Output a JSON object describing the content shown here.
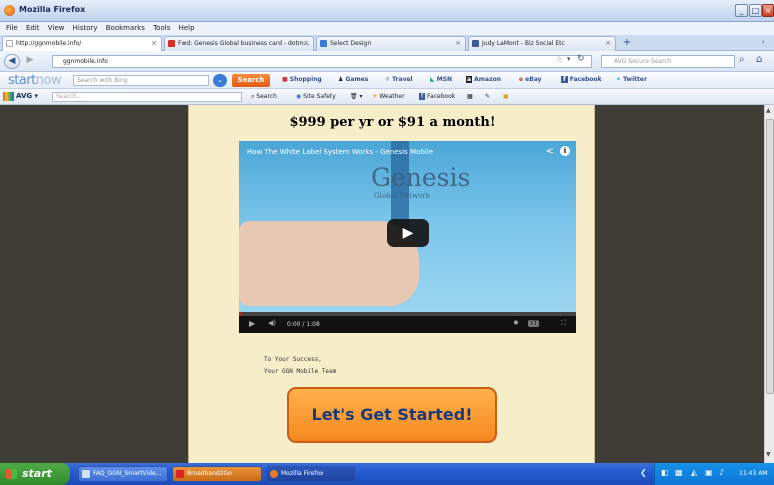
{
  "window": {
    "title": "Mozilla Firefox"
  },
  "menu": [
    "File",
    "Edit",
    "View",
    "History",
    "Bookmarks",
    "Tools",
    "Help"
  ],
  "tabs": [
    {
      "label": "http://ggnmobile.info/",
      "active": true
    },
    {
      "label": "Fwd: Genesis Global business card - dotm...",
      "active": false
    },
    {
      "label": "Select Design",
      "active": false
    },
    {
      "label": "Judy LaMont - Biz Social Etc",
      "active": false
    }
  ],
  "nav": {
    "url": "ggnmobile.info",
    "search_placeholder": "AVG Secure Search"
  },
  "startnow": {
    "logo_a": "start",
    "logo_b": "now",
    "search_placeholder": "Search with Bing",
    "search_button": "Search",
    "links": [
      "Shopping",
      "Games",
      "Travel",
      "MSN",
      "Amazon",
      "eBay",
      "Facebook",
      "Twitter"
    ]
  },
  "avg": {
    "logo": "AVG",
    "search_placeholder": "Search...",
    "links": [
      "Search",
      "Site Safety",
      "Weather",
      "Facebook"
    ]
  },
  "page": {
    "price": "$999 per yr or $91 a month!",
    "video": {
      "title": "How The White Label System Works - Genesis Mobile",
      "brand": "Genesis",
      "brand_sub": "Global Network",
      "time": "0:00 / 1:08",
      "progress": 0.01
    },
    "signoff_1": "To Your Success,",
    "signoff_2": "Your GGN Mobile Team",
    "cta": "Let's Get Started!"
  },
  "taskbar": {
    "start": "start",
    "items": [
      {
        "label": "FAQ_GGN_SmartVide...",
        "active": false
      },
      {
        "label": "Broadband2Go",
        "active": false
      },
      {
        "label": "Mozilla Firefox",
        "active": true
      }
    ],
    "clock": "11:43 AM"
  }
}
